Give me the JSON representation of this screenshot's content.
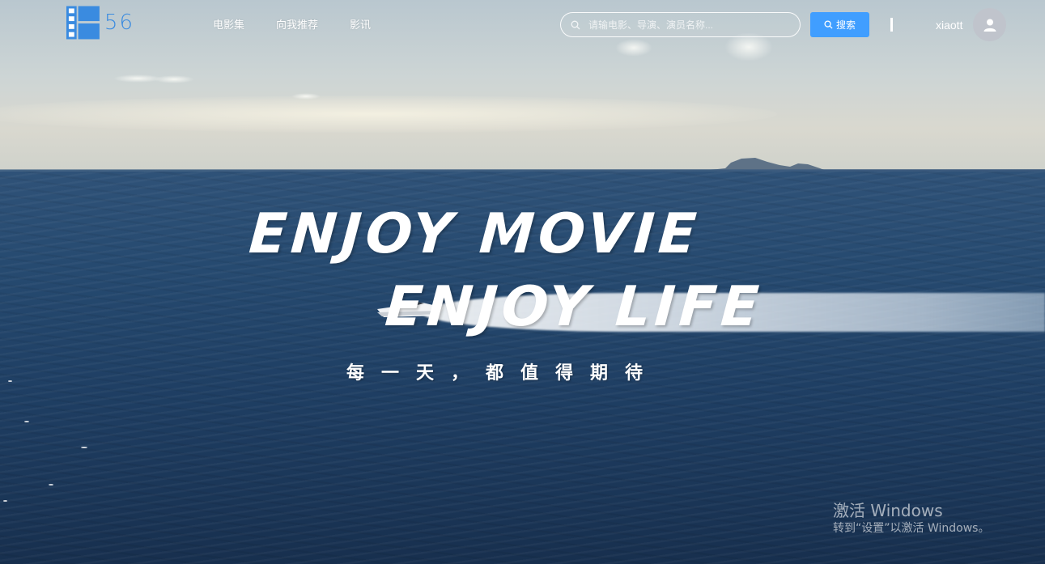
{
  "header": {
    "logo_text": "56",
    "nav": [
      {
        "label": "电影集"
      },
      {
        "label": "向我推荐"
      },
      {
        "label": "影讯"
      }
    ],
    "search": {
      "placeholder": "请输电影、导演、演员名称...",
      "value": "",
      "button_label": "搜索"
    },
    "user": {
      "name": "xiaott"
    }
  },
  "hero": {
    "line1": "ENJOY MOVIE",
    "line2": "ENJOY LIFE",
    "subtitle": "每一天，都值得期待"
  },
  "watermark": {
    "title": "激活 Windows",
    "subtitle": "转到“设置”以激活 Windows。"
  },
  "colors": {
    "accent": "#409eff",
    "logo": "#3a8be0",
    "avatar_bg": "#c0c4cc"
  },
  "icons": {
    "logo": "film-strip-icon",
    "search": "search-icon",
    "avatar": "user-icon"
  }
}
